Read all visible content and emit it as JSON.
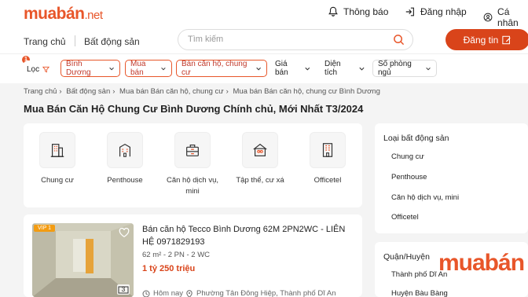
{
  "header": {
    "logo_main": "muabán",
    "logo_suffix": ".net",
    "notifications_label": "Thông báo",
    "login_label": "Đăng nhập",
    "profile_label": "Cá nhân",
    "nav": [
      "Trang chủ",
      "Bất động sản"
    ],
    "search_placeholder": "Tìm kiếm",
    "post_button": "Đăng tin",
    "accent_color": "#e8562a"
  },
  "filters": {
    "badge_count": "1",
    "items": [
      {
        "label": "Lọc",
        "active": false
      },
      {
        "label": "Bình Dương",
        "active": true
      },
      {
        "label": "Mua bán",
        "active": true
      },
      {
        "label": "Bán căn hộ, chung cư",
        "active": true
      },
      {
        "label": "Giá bán",
        "active": false
      },
      {
        "label": "Diện tích",
        "active": false
      },
      {
        "label": "Số phòng ngủ",
        "active": false
      }
    ]
  },
  "breadcrumb": [
    "Trang chủ",
    "Bất động sản",
    "Mua bán Bán căn hộ, chung cư",
    "Mua bán Bán căn hộ, chung cư Bình Dương"
  ],
  "page_title": "Mua Bán Căn Hộ Chung Cư Bình Dương Chính chủ, Mới Nhất T3/2024",
  "categories": [
    {
      "label": "Chung cư",
      "icon": "apartment-building-icon"
    },
    {
      "label": "Penthouse",
      "icon": "penthouse-icon"
    },
    {
      "label": "Căn hộ dịch vụ, mini",
      "icon": "service-apartment-icon"
    },
    {
      "label": "Tập thể, cư xá",
      "icon": "collective-housing-icon"
    },
    {
      "label": "Officetel",
      "icon": "officetel-icon"
    }
  ],
  "sidebar": {
    "property_type_title": "Loại bất động sản",
    "property_types": [
      "Chung cư",
      "Penthouse",
      "Căn hộ dịch vụ, mini",
      "Officetel"
    ],
    "district_title": "Quận/Huyện",
    "districts": [
      "Thành phố Dĩ An",
      "Huyện Bàu Bàng"
    ]
  },
  "listing": {
    "vip_label": "VIP 1",
    "title": "Bán căn hộ Tecco Bình Dương 62M 2PN2WC - LIÊN HỆ 0971829193",
    "meta": "62 m² - 2 PN - 2 WC",
    "price": "1 tỷ 250 triệu",
    "photo_count": "3",
    "time": "Hôm nay",
    "location": "Phường Tân Đông Hiệp, Thành phố Dĩ An"
  },
  "watermark": "muabán"
}
